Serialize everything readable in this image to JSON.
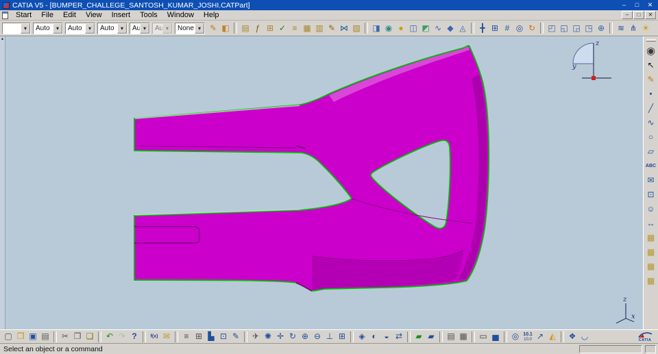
{
  "window": {
    "title": "CATIA V5 - [BUMPER_CHALLEGE_SANTOSH_KUMAR_JOSHI.CATPart]",
    "controls": {
      "minimize": "–",
      "maximize": "□",
      "close": "✕"
    }
  },
  "menu": {
    "items": [
      {
        "name": "menu-start",
        "label": "Start"
      },
      {
        "name": "menu-file",
        "label": "File"
      },
      {
        "name": "menu-edit",
        "label": "Edit"
      },
      {
        "name": "menu-view",
        "label": "View"
      },
      {
        "name": "menu-insert",
        "label": "Insert"
      },
      {
        "name": "menu-tools",
        "label": "Tools"
      },
      {
        "name": "menu-window",
        "label": "Window"
      },
      {
        "name": "menu-help",
        "label": "Help"
      }
    ],
    "mdi": {
      "minimize": "–",
      "restore": "□",
      "close": "✕"
    }
  },
  "format_bar": {
    "arrow_glyph": "▾",
    "combos": [
      {
        "name": "graphic-color-combo",
        "value": "",
        "cls": "w-color"
      },
      {
        "name": "transparency-combo",
        "value": "Auto",
        "cls": "w-std"
      },
      {
        "name": "line-type-combo",
        "value": "Auto",
        "cls": "w-std"
      },
      {
        "name": "line-weight-combo",
        "value": "Auto",
        "cls": "w-std"
      },
      {
        "name": "point-type-combo",
        "value": "Aut",
        "cls": "w-sm"
      },
      {
        "name": "symbol-type-combo",
        "value": "Aut",
        "cls": "w-sm dim"
      },
      {
        "name": "layer-combo",
        "value": "None",
        "cls": "w-std"
      }
    ]
  },
  "top_toolbar": {
    "items": [
      {
        "name": "copy-graphic-properties-icon",
        "glyph": "✎",
        "color": "#b8860b"
      },
      {
        "name": "graphic-wizard-icon",
        "glyph": "◧",
        "color": "#c08228"
      },
      {
        "sep": true
      },
      {
        "name": "datum-sheet-icon",
        "glyph": "▤",
        "color": "#a8862e"
      },
      {
        "name": "formula-icon",
        "glyph": "ƒ",
        "color": "#7a5f10"
      },
      {
        "name": "design-table-icon",
        "glyph": "⊞",
        "color": "#a8862e"
      },
      {
        "name": "check-icon",
        "glyph": "✓",
        "color": "#1f7f1f"
      },
      {
        "name": "rule-icon",
        "glyph": "≡",
        "color": "#a8862e"
      },
      {
        "name": "catalog-sheet-icon",
        "glyph": "▦",
        "color": "#a8862e"
      },
      {
        "name": "report-icon",
        "glyph": "▥",
        "color": "#a8862e"
      },
      {
        "name": "annotation-pen-icon",
        "glyph": "✎",
        "color": "#8a6a14"
      },
      {
        "name": "link-icon",
        "glyph": "⋈",
        "color": "#2a5a9a"
      },
      {
        "name": "scan-icon",
        "glyph": "▧",
        "color": "#a8862e"
      },
      {
        "sep": true
      },
      {
        "name": "extrude-surface-icon",
        "glyph": "◨",
        "color": "#3a68b0"
      },
      {
        "name": "revolve-surface-icon",
        "glyph": "◉",
        "color": "#2e8b8b"
      },
      {
        "name": "sphere-surface-icon",
        "glyph": "●",
        "color": "#d09a17"
      },
      {
        "name": "cylinder-surface-icon",
        "glyph": "◫",
        "color": "#3a68b0"
      },
      {
        "name": "offset-surface-icon",
        "glyph": "◩",
        "color": "#3a9a6a"
      },
      {
        "name": "sweep-surface-icon",
        "glyph": "∿",
        "color": "#3a68b0"
      },
      {
        "name": "fill-surface-icon",
        "glyph": "◆",
        "color": "#3a68b0"
      },
      {
        "name": "blend-surface-icon",
        "glyph": "◬",
        "color": "#3a68b0"
      },
      {
        "sep": true
      },
      {
        "name": "axis-system-icon",
        "glyph": "╋",
        "color": "#20509f"
      },
      {
        "name": "work-grid-icon",
        "glyph": "⊞",
        "color": "#20509f"
      },
      {
        "name": "snap-to-grid-icon",
        "glyph": "#",
        "color": "#20509f"
      },
      {
        "name": "compass-tool-icon",
        "glyph": "◎",
        "color": "#20509f"
      },
      {
        "name": "update-icon",
        "glyph": "↻",
        "color": "#d07010"
      },
      {
        "sep": true
      },
      {
        "name": "front-view-icon",
        "glyph": "◰",
        "color": "#3060b0"
      },
      {
        "name": "cutting-plane-icon",
        "glyph": "◱",
        "color": "#3060b0"
      },
      {
        "name": "depth-effect-icon",
        "glyph": "◲",
        "color": "#3060b0"
      },
      {
        "name": "layer-filter-icon",
        "glyph": "◳",
        "color": "#3060b0"
      },
      {
        "name": "magnifier-icon",
        "glyph": "⊕",
        "color": "#3060b0"
      },
      {
        "sep": true
      },
      {
        "name": "curvature-comb-icon",
        "glyph": "≋",
        "color": "#20509f"
      },
      {
        "name": "porcupine-analysis-icon",
        "glyph": "⋔",
        "color": "#20509f"
      },
      {
        "name": "light-source-icon",
        "glyph": "☀",
        "color": "#c89a00"
      }
    ]
  },
  "right_toolbar": {
    "items": [
      {
        "name": "current-workbench-icon",
        "glyph": "◉",
        "color": "#3a3a3a",
        "cls": "big"
      },
      {
        "name": "select-arrow-icon",
        "glyph": "↖",
        "color": "#101010"
      },
      {
        "name": "style-pen-icon",
        "glyph": "✎",
        "color": "#b8860b"
      },
      {
        "name": "point-icon",
        "glyph": "•",
        "color": "#20509f"
      },
      {
        "name": "line-icon",
        "glyph": "╱",
        "color": "#20509f"
      },
      {
        "name": "spline-icon",
        "glyph": "∿",
        "color": "#20509f"
      },
      {
        "name": "circle-icon",
        "glyph": "○",
        "color": "#20509f"
      },
      {
        "name": "plane-icon",
        "glyph": "▱",
        "color": "#20509f"
      },
      {
        "name": "text-annotation-icon",
        "glyph": "ABC",
        "color": "#1f3f8f",
        "cls": "txt"
      },
      {
        "name": "comment-icon",
        "glyph": "✉",
        "color": "#20509f"
      },
      {
        "name": "capture-icon",
        "glyph": "⊡",
        "color": "#20509f"
      },
      {
        "name": "manikin-icon",
        "glyph": "☺",
        "color": "#20509f"
      },
      {
        "name": "measure-icon",
        "glyph": "↔",
        "color": "#20509f"
      },
      {
        "name": "catalog-browser-icon",
        "glyph": "▦",
        "color": "#b8962e"
      },
      {
        "name": "instantiate-from-document-icon",
        "glyph": "▦",
        "color": "#b8962e"
      },
      {
        "name": "save-in-catalog-icon",
        "glyph": "▦",
        "color": "#b8962e"
      },
      {
        "name": "update-catalog-icon",
        "glyph": "▦",
        "color": "#b8962e"
      }
    ]
  },
  "bottom_toolbar": {
    "items": [
      {
        "name": "new-document-icon",
        "glyph": "▢",
        "color": "#505050"
      },
      {
        "name": "open-icon",
        "glyph": "❒",
        "color": "#c8950a"
      },
      {
        "name": "save-icon",
        "glyph": "▣",
        "color": "#20509f"
      },
      {
        "name": "print-icon",
        "glyph": "▤",
        "color": "#585858"
      },
      {
        "sep": true
      },
      {
        "name": "cut-icon",
        "glyph": "✂",
        "color": "#585858"
      },
      {
        "name": "copy-icon",
        "glyph": "❐",
        "color": "#585858"
      },
      {
        "name": "paste-icon",
        "glyph": "❑",
        "color": "#8a6914"
      },
      {
        "sep": true
      },
      {
        "name": "undo-icon",
        "glyph": "↶",
        "color": "#1f8f1f"
      },
      {
        "name": "redo-icon",
        "glyph": "↷",
        "color": "#9ec79e"
      },
      {
        "name": "whats-this-icon",
        "glyph": "?",
        "color": "#1f4fa0",
        "cls": "bold"
      },
      {
        "sep": true
      },
      {
        "name": "formula-bottom-icon",
        "glyph": "f(x)",
        "color": "#1f3f8f",
        "cls": "txt"
      },
      {
        "name": "knowledge-comment-icon",
        "glyph": "✉",
        "color": "#b8962e"
      },
      {
        "sep": true
      },
      {
        "name": "specification-tree-icon",
        "glyph": "≡",
        "color": "#505050"
      },
      {
        "name": "data-table-icon",
        "glyph": "⊞",
        "color": "#505050"
      },
      {
        "name": "chart-icon",
        "glyph": "▙",
        "color": "#20509f"
      },
      {
        "name": "capture-image-icon",
        "glyph": "⊡",
        "color": "#20509f"
      },
      {
        "name": "edit-pen-icon",
        "glyph": "✎",
        "color": "#20509f"
      },
      {
        "sep": true
      },
      {
        "name": "fly-mode-icon",
        "glyph": "✈",
        "color": "#505050"
      },
      {
        "name": "fit-all-in-icon",
        "glyph": "✺",
        "color": "#20509f"
      },
      {
        "name": "pan-icon",
        "glyph": "✛",
        "color": "#20509f"
      },
      {
        "name": "rotate-icon",
        "glyph": "↻",
        "color": "#20509f"
      },
      {
        "name": "zoom-in-icon",
        "glyph": "⊕",
        "color": "#20509f"
      },
      {
        "name": "zoom-out-icon",
        "glyph": "⊖",
        "color": "#20509f"
      },
      {
        "name": "normal-view-icon",
        "glyph": "⊥",
        "color": "#20509f"
      },
      {
        "name": "multi-view-icon",
        "glyph": "⊞",
        "color": "#20509f"
      },
      {
        "sep": true
      },
      {
        "name": "quick-view-icon",
        "glyph": "◈",
        "color": "#20509f"
      },
      {
        "name": "render-style-icon",
        "glyph": "◐",
        "color": "#20509f"
      },
      {
        "name": "hide-show-icon",
        "glyph": "◒",
        "color": "#20509f"
      },
      {
        "name": "swap-visible-space-icon",
        "glyph": "⇄",
        "color": "#20509f"
      },
      {
        "sep": true
      },
      {
        "name": "save-version-icon",
        "glyph": "▰",
        "color": "#1f8f1f"
      },
      {
        "name": "browse-window-icon",
        "glyph": "▰",
        "color": "#20509f"
      },
      {
        "sep": true
      },
      {
        "name": "print-setup-icon",
        "glyph": "▤",
        "color": "#505050"
      },
      {
        "name": "options-grid-icon",
        "glyph": "▦",
        "color": "#505050"
      },
      {
        "sep": true
      },
      {
        "name": "vault-drive-icon",
        "glyph": "▭",
        "color": "#404040"
      },
      {
        "name": "analysis-histogram-icon",
        "glyph": "▅",
        "color": "#20509f"
      },
      {
        "sep": true
      },
      {
        "name": "datum-target-icon",
        "glyph": "◎",
        "color": "#20509f"
      },
      {
        "name": "measure-between-icon",
        "glyph": "10.1",
        "glyph2": "10.0",
        "color": "#1f3f8f",
        "cls": "txt"
      },
      {
        "name": "measure-item-icon",
        "glyph": "↗",
        "color": "#20509f"
      },
      {
        "name": "mass-properties-icon",
        "glyph": "◭",
        "color": "#d09a17"
      },
      {
        "sep": true
      },
      {
        "name": "reframe-icon",
        "glyph": "❖",
        "color": "#20509f"
      },
      {
        "name": "spline-analysis-icon",
        "glyph": "◡",
        "color": "#20509f"
      }
    ]
  },
  "viewport": {
    "strip_glyph": "▴",
    "compass": {
      "z": "z",
      "y": "y"
    },
    "axis_triad": {
      "z": "z",
      "x": "x"
    },
    "part": {
      "fill": "#cb00cb",
      "outline": "#00bd00"
    }
  },
  "logo": {
    "text": "CATIA"
  },
  "status_bar": {
    "message": "Select an object or a command"
  }
}
